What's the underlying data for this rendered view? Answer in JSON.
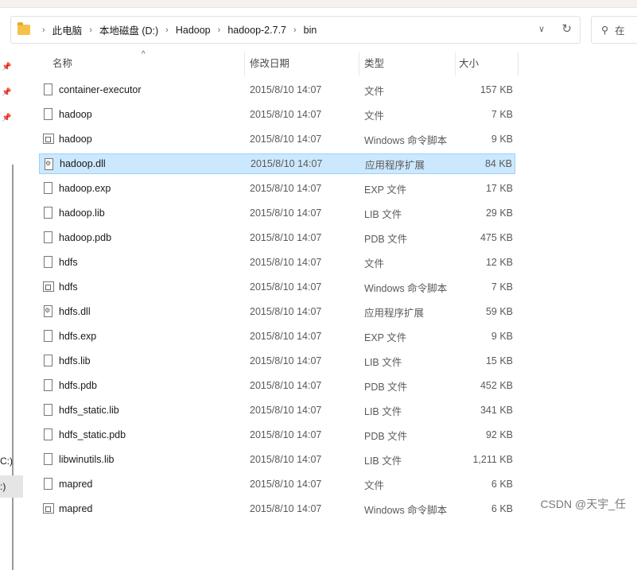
{
  "breadcrumb": [
    "此电脑",
    "本地磁盘 (D:)",
    "Hadoop",
    "hadoop-2.7.7",
    "bin"
  ],
  "search": {
    "placeholder": "在"
  },
  "nav": {
    "drive_c": "C:)",
    "drive_d": ":)"
  },
  "columns": {
    "name": "名称",
    "date": "修改日期",
    "type": "类型",
    "size": "大小"
  },
  "files": [
    {
      "name": "container-executor",
      "date": "2015/8/10 14:07",
      "type": "文件",
      "size": "157 KB",
      "icon": "file"
    },
    {
      "name": "hadoop",
      "date": "2015/8/10 14:07",
      "type": "文件",
      "size": "7 KB",
      "icon": "file"
    },
    {
      "name": "hadoop",
      "date": "2015/8/10 14:07",
      "type": "Windows 命令脚本",
      "size": "9 KB",
      "icon": "script"
    },
    {
      "name": "hadoop.dll",
      "date": "2015/8/10 14:07",
      "type": "应用程序扩展",
      "size": "84 KB",
      "icon": "dll",
      "selected": true
    },
    {
      "name": "hadoop.exp",
      "date": "2015/8/10 14:07",
      "type": "EXP 文件",
      "size": "17 KB",
      "icon": "file"
    },
    {
      "name": "hadoop.lib",
      "date": "2015/8/10 14:07",
      "type": "LIB 文件",
      "size": "29 KB",
      "icon": "file"
    },
    {
      "name": "hadoop.pdb",
      "date": "2015/8/10 14:07",
      "type": "PDB 文件",
      "size": "475 KB",
      "icon": "file"
    },
    {
      "name": "hdfs",
      "date": "2015/8/10 14:07",
      "type": "文件",
      "size": "12 KB",
      "icon": "file"
    },
    {
      "name": "hdfs",
      "date": "2015/8/10 14:07",
      "type": "Windows 命令脚本",
      "size": "7 KB",
      "icon": "script"
    },
    {
      "name": "hdfs.dll",
      "date": "2015/8/10 14:07",
      "type": "应用程序扩展",
      "size": "59 KB",
      "icon": "dll"
    },
    {
      "name": "hdfs.exp",
      "date": "2015/8/10 14:07",
      "type": "EXP 文件",
      "size": "9 KB",
      "icon": "file"
    },
    {
      "name": "hdfs.lib",
      "date": "2015/8/10 14:07",
      "type": "LIB 文件",
      "size": "15 KB",
      "icon": "file"
    },
    {
      "name": "hdfs.pdb",
      "date": "2015/8/10 14:07",
      "type": "PDB 文件",
      "size": "452 KB",
      "icon": "file"
    },
    {
      "name": "hdfs_static.lib",
      "date": "2015/8/10 14:07",
      "type": "LIB 文件",
      "size": "341 KB",
      "icon": "file"
    },
    {
      "name": "hdfs_static.pdb",
      "date": "2015/8/10 14:07",
      "type": "PDB 文件",
      "size": "92 KB",
      "icon": "file"
    },
    {
      "name": "libwinutils.lib",
      "date": "2015/8/10 14:07",
      "type": "LIB 文件",
      "size": "1,211 KB",
      "icon": "file"
    },
    {
      "name": "mapred",
      "date": "2015/8/10 14:07",
      "type": "文件",
      "size": "6 KB",
      "icon": "file"
    },
    {
      "name": "mapred",
      "date": "2015/8/10 14:07",
      "type": "Windows 命令脚本",
      "size": "6 KB",
      "icon": "script"
    }
  ],
  "watermark": "CSDN @天宇_任"
}
